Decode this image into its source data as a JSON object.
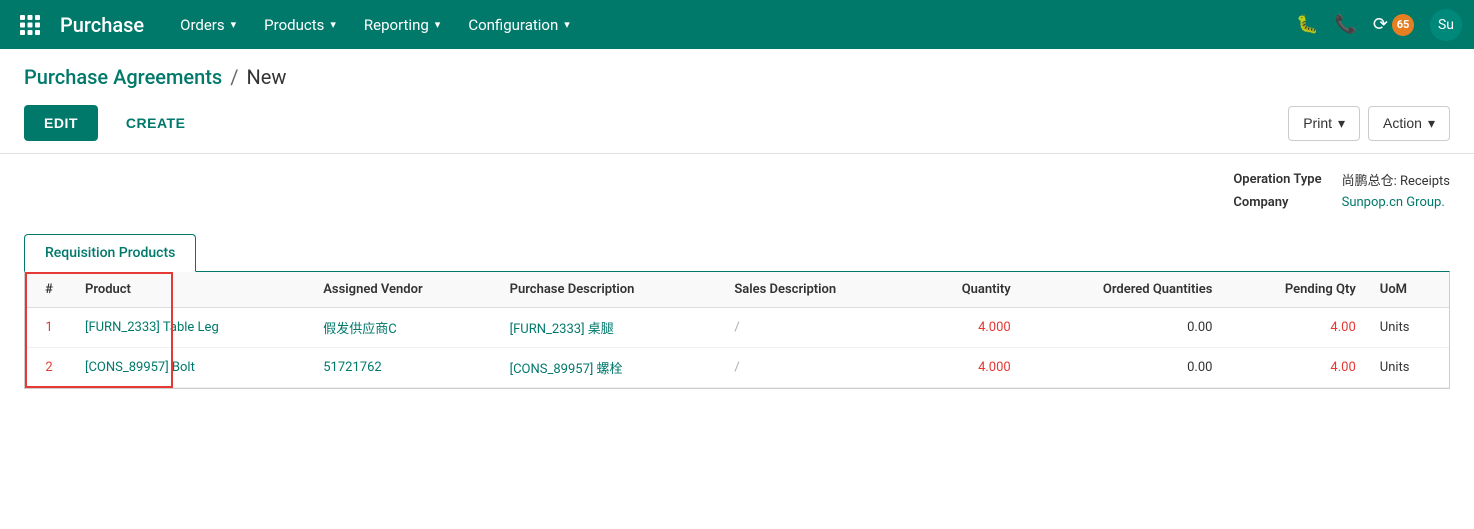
{
  "app": {
    "name": "Purchase",
    "grid_icon": "⊞"
  },
  "nav": {
    "items": [
      {
        "label": "Orders",
        "id": "orders"
      },
      {
        "label": "Products",
        "id": "products"
      },
      {
        "label": "Reporting",
        "id": "reporting"
      },
      {
        "label": "Configuration",
        "id": "configuration"
      }
    ],
    "badge_count": "65",
    "icons": [
      "🐛",
      "📞"
    ]
  },
  "breadcrumb": {
    "parent": "Purchase Agreements",
    "separator": "/",
    "current": "New"
  },
  "toolbar": {
    "edit_label": "EDIT",
    "create_label": "CREATE",
    "print_label": "Print",
    "action_label": "Action"
  },
  "info_panel": {
    "operation_type_label": "Operation Type",
    "operation_type_value": "尚鹏总仓: Receipts",
    "company_label": "Company",
    "company_value": "Sunpop.cn Group."
  },
  "tab": {
    "label": "Requisition Products"
  },
  "table": {
    "columns": [
      "#",
      "Product",
      "Assigned Vendor",
      "Purchase Description",
      "Sales Description",
      "Quantity",
      "Ordered Quantities",
      "Pending Qty",
      "UoM"
    ],
    "rows": [
      {
        "num": "1",
        "product": "[FURN_2333] Table Leg",
        "vendor": "假发供应商C",
        "purchase_desc": "[FURN_2333] 桌腿",
        "sales_desc": "/",
        "quantity": "4.000",
        "ordered_qty": "0.00",
        "pending_qty": "4.00",
        "uom": "Units"
      },
      {
        "num": "2",
        "product": "[CONS_89957] Bolt",
        "vendor": "51721762",
        "purchase_desc": "[CONS_89957] 螺栓",
        "sales_desc": "/",
        "quantity": "4.000",
        "ordered_qty": "0.00",
        "pending_qty": "4.00",
        "uom": "Units"
      }
    ]
  }
}
